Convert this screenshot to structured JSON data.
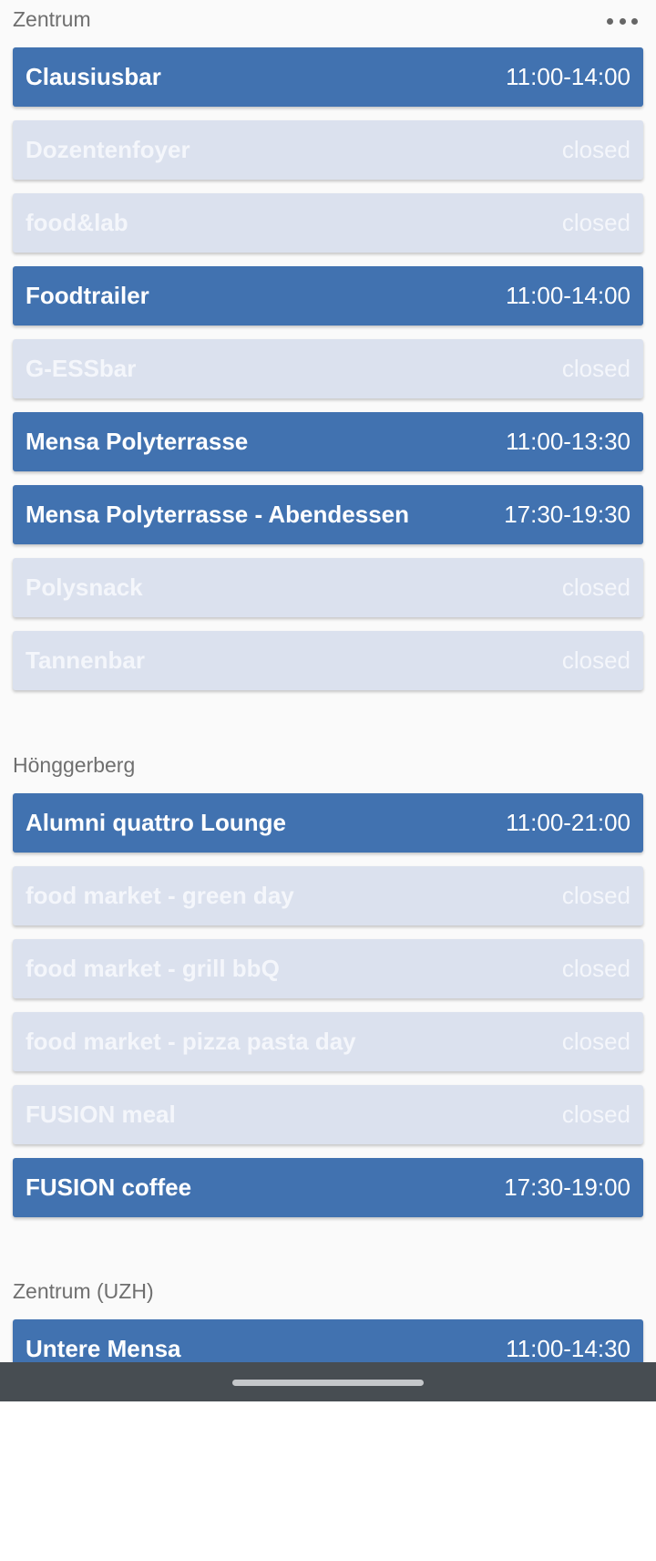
{
  "sections": [
    {
      "title": "Zentrum",
      "items": [
        {
          "name": "Clausiusbar",
          "hours": "11:00-14:00"
        },
        {
          "name": "Dozentenfoyer",
          "hours": "closed"
        },
        {
          "name": "food&lab",
          "hours": "closed"
        },
        {
          "name": "Foodtrailer",
          "hours": "11:00-14:00"
        },
        {
          "name": "G-ESSbar",
          "hours": "closed"
        },
        {
          "name": "Mensa Polyterrasse",
          "hours": "11:00-13:30"
        },
        {
          "name": "Mensa Polyterrasse - Abendessen",
          "hours": "17:30-19:30"
        },
        {
          "name": "Polysnack",
          "hours": "closed"
        },
        {
          "name": "Tannenbar",
          "hours": "closed"
        }
      ]
    },
    {
      "title": "Hönggerberg",
      "items": [
        {
          "name": "Alumni quattro Lounge",
          "hours": "11:00-21:00"
        },
        {
          "name": "food market - green day",
          "hours": "closed"
        },
        {
          "name": "food market - grill bbQ",
          "hours": "closed"
        },
        {
          "name": "food market - pizza pasta day",
          "hours": "closed"
        },
        {
          "name": "FUSION meal",
          "hours": "closed"
        },
        {
          "name": "FUSION coffee",
          "hours": "17:30-19:00"
        }
      ]
    },
    {
      "title": "Zentrum (UZH)",
      "items": [
        {
          "name": "Untere Mensa",
          "hours": "11:00-14:30"
        }
      ]
    }
  ],
  "icons": {
    "menu": "more-horizontal-icon"
  },
  "colors": {
    "open_row": "#4172b0",
    "closed_row": "#dbe1ee",
    "nav_bar": "#474d52"
  }
}
